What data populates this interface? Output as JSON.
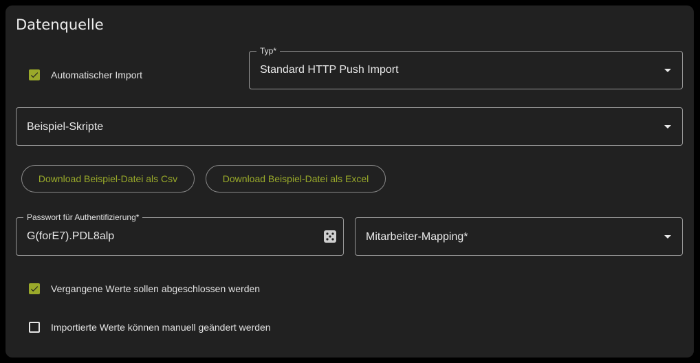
{
  "section": {
    "title": "Datenquelle"
  },
  "auto_import": {
    "label": "Automatischer Import",
    "checked": true
  },
  "type_select": {
    "label": "Typ*",
    "value": "Standard HTTP Push Import"
  },
  "example_scripts": {
    "value": "Beispiel-Skripte"
  },
  "downloads": {
    "csv_label": "Download Beispiel-Datei als Csv",
    "excel_label": "Download Beispiel-Datei als Excel"
  },
  "password": {
    "label": "Passwort für Authentifizierung*",
    "value": "G(forE7).PDL8alp",
    "icon": "dice-icon"
  },
  "employee_mapping": {
    "value": "Mitarbeiter-Mapping*"
  },
  "close_past": {
    "label": "Vergangene Werte sollen abgeschlossen werden",
    "checked": true
  },
  "manual_edit": {
    "label": "Importierte Werte können manuell geändert werden",
    "checked": false
  },
  "colors": {
    "accent": "#9aa92a",
    "card_background": "#212121",
    "border": "#9a9a9a"
  }
}
